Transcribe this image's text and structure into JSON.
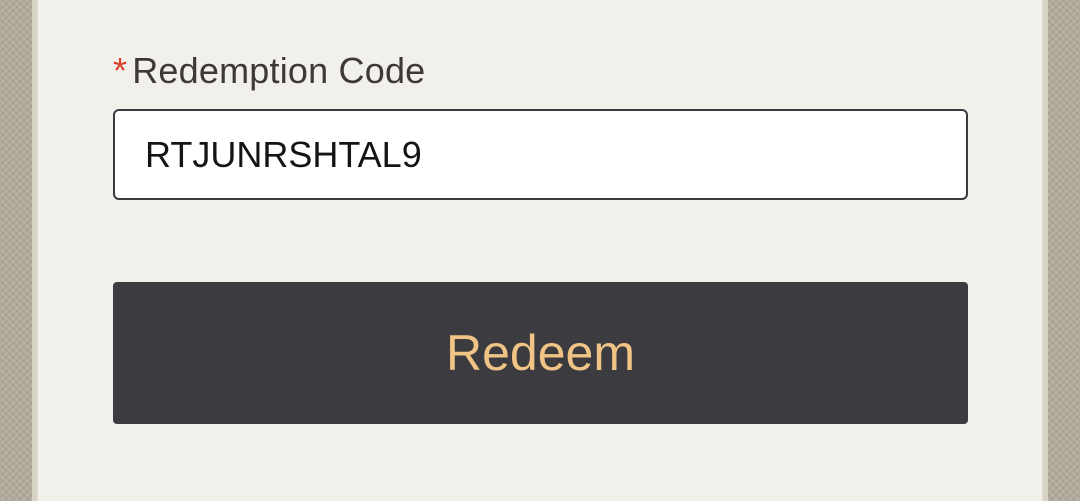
{
  "form": {
    "required_marker": "*",
    "code_label": "Redemption Code",
    "code_value": "RTJUNRSHTAL9",
    "redeem_label": "Redeem"
  },
  "colors": {
    "required": "#d8412a",
    "button_bg": "#3b3b40",
    "button_text": "#efc485",
    "panel_bg": "#f2f0ea"
  }
}
